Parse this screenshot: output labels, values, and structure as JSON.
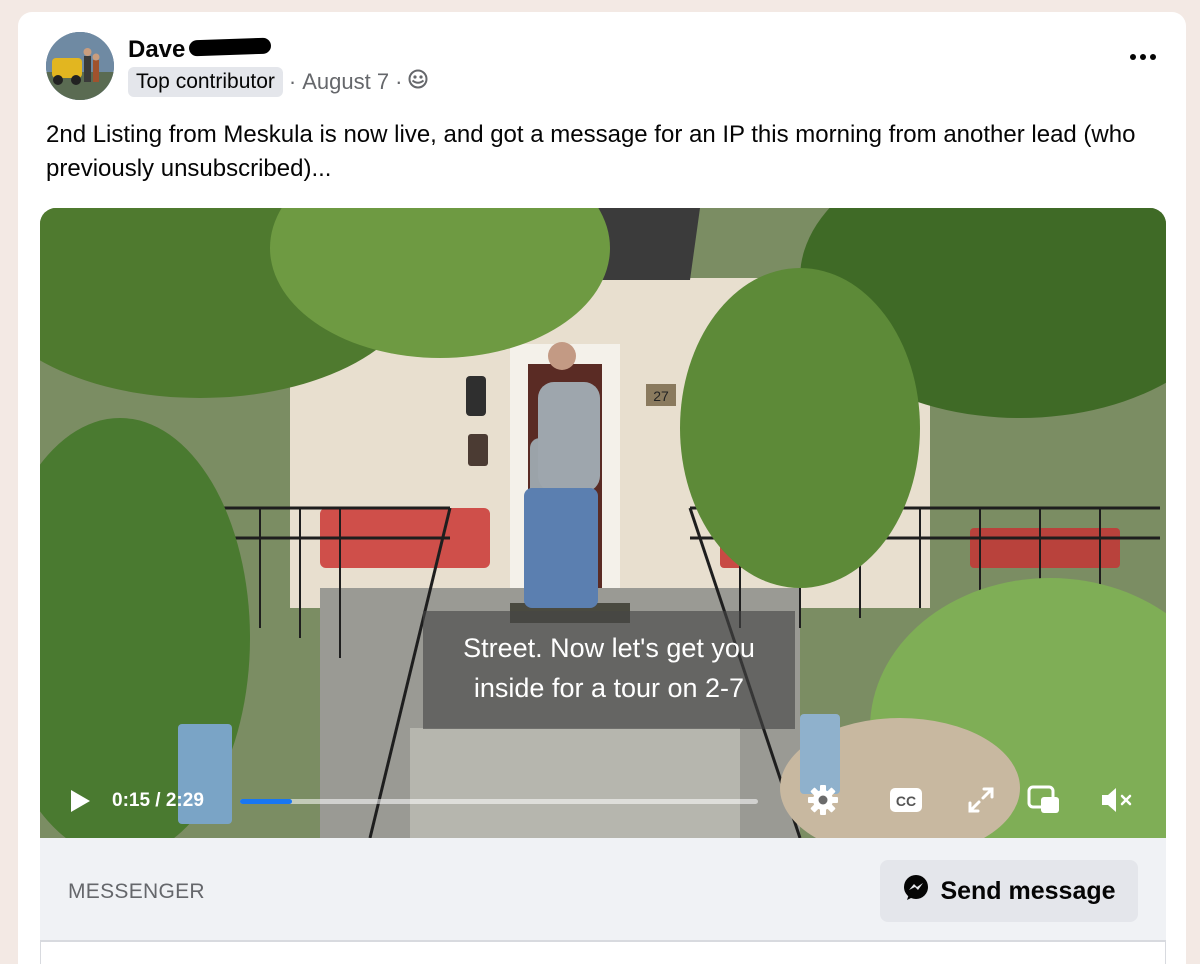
{
  "post": {
    "author": "Dave",
    "badge": "Top contributor",
    "separator": "·",
    "date": "August 7",
    "text": "2nd Listing from Meskula is now live, and got a message for an IP this morning from another lead (who previously unsubscribed)..."
  },
  "video": {
    "house_number": "27",
    "caption_line1": "Street. Now let's get you",
    "caption_line2": "inside for a tour on 2-7",
    "time": "0:15 / 2:29",
    "progress": 0.1,
    "icons": [
      "play-icon",
      "settings-icon",
      "closed-captions-icon",
      "fullscreen-icon",
      "picture-in-picture-icon",
      "muted-volume-icon"
    ]
  },
  "footer": {
    "label": "MESSENGER",
    "button": "Send message"
  },
  "colors": {
    "accent": "#1877f2",
    "card": "#ffffff",
    "page": "#f3e9e4",
    "footer": "#f0f2f5"
  }
}
